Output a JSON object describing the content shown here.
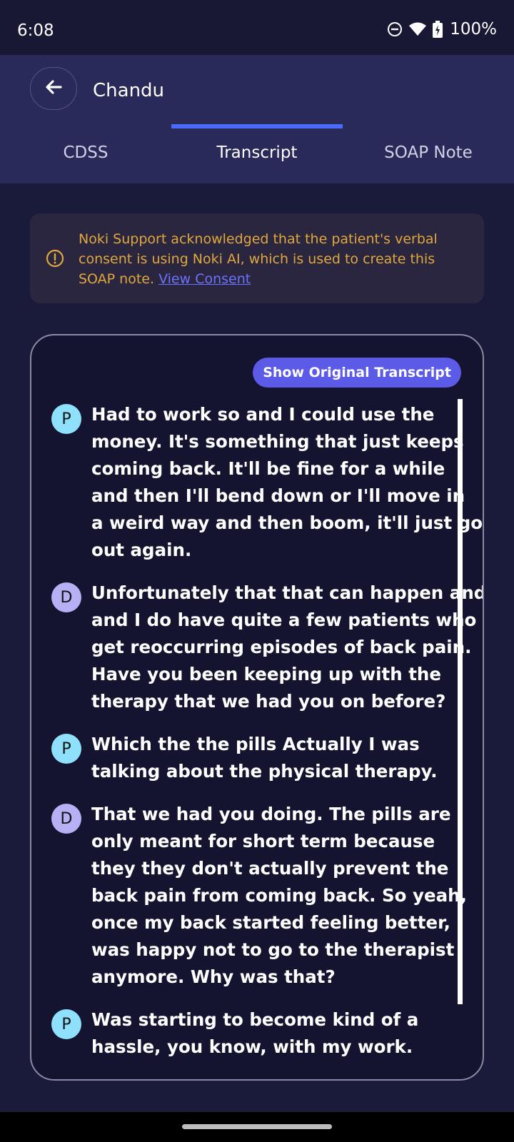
{
  "status": {
    "time": "6:08",
    "battery": "100%"
  },
  "header": {
    "title": "Chandu"
  },
  "tabs": [
    {
      "label": "CDSS"
    },
    {
      "label": "Transcript"
    },
    {
      "label": "SOAP Note"
    }
  ],
  "consent": {
    "text": "Noki Support acknowledged that the patient's verbal consent is using Noki AI, which is used to create this SOAP note.",
    "link": "View Consent"
  },
  "transcript": {
    "show_original_label": "Show Original Transcript",
    "messages": [
      {
        "speaker": "P",
        "lines": [
          "Had to work so and I could use the",
          "money. It's something that just keeps",
          "coming back. It'll be fine for a while",
          "and then I'll bend down or I'll move in",
          "a weird way and then boom, it'll just go",
          "out again."
        ]
      },
      {
        "speaker": "D",
        "lines": [
          "Unfortunately that that can happen and",
          "and I do have quite a few patients who",
          "get reoccurring episodes of back pain.",
          "Have you been keeping up with the",
          "therapy that we had you on before?"
        ]
      },
      {
        "speaker": "P",
        "lines": [
          "Which the the pills Actually I was",
          "talking about the physical therapy."
        ]
      },
      {
        "speaker": "D",
        "lines": [
          "That we had you doing. The pills are",
          "only meant for short term because",
          "they they don't actually prevent the",
          "back pain from coming back. So yeah,",
          "once my back started feeling better, I",
          "was happy not to go to the therapist",
          "anymore. Why was that?"
        ]
      },
      {
        "speaker": "P",
        "lines": [
          "Was starting to become kind of a",
          "hassle, you know, with my work."
        ]
      }
    ]
  },
  "colors": {
    "background": "#1a1a3a",
    "header": "#2a2a5a",
    "accent": "#4a6cf7",
    "consent_text": "#e0a73c",
    "patient_avatar": "#8fe1fb",
    "doctor_avatar": "#b7b0f4"
  },
  "icons": {
    "back": "arrow-left-icon",
    "info": "info-circle-icon",
    "dnd": "do-not-disturb-icon",
    "wifi": "wifi-icon",
    "battery": "battery-charging-icon"
  }
}
